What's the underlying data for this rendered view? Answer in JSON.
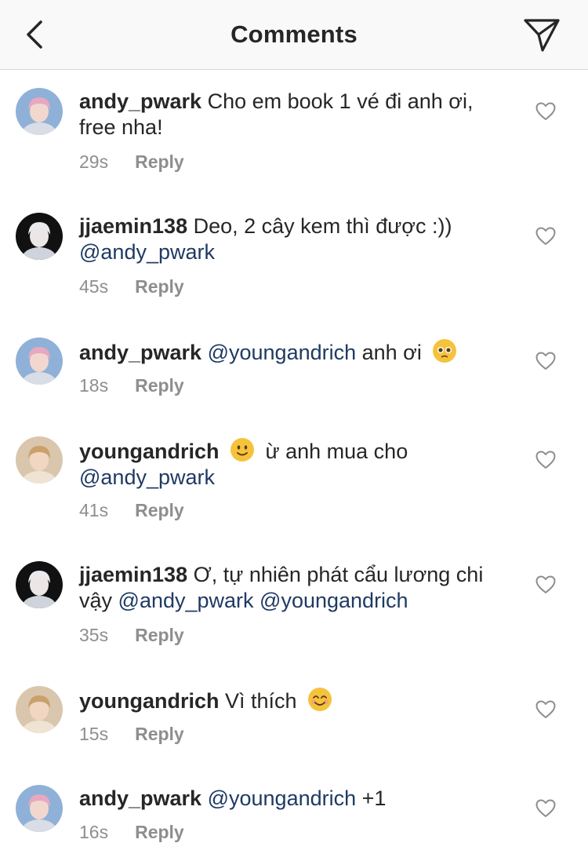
{
  "header": {
    "title": "Comments",
    "back_icon": "chevron-left-icon",
    "share_icon": "paper-plane-icon"
  },
  "reply_label": "Reply",
  "comments": [
    {
      "username": "andy_pwark",
      "parts": [
        {
          "t": "text",
          "v": "Cho em book 1 vé đi anh ơi,"
        },
        {
          "t": "br"
        },
        {
          "t": "text",
          "v": "free nha!"
        }
      ],
      "time": "29s",
      "avatar": "pink"
    },
    {
      "username": "jjaemin138",
      "parts": [
        {
          "t": "text",
          "v": "Deo, 2 cây kem thì được :))"
        },
        {
          "t": "br"
        },
        {
          "t": "mention",
          "v": "@andy_pwark"
        }
      ],
      "time": "45s",
      "avatar": "dark"
    },
    {
      "username": "andy_pwark",
      "parts": [
        {
          "t": "mention",
          "v": "@youngandrich"
        },
        {
          "t": "text",
          "v": " anh ơi "
        },
        {
          "t": "emoji",
          "v": "pleading-face-emoji"
        }
      ],
      "time": "18s",
      "avatar": "pink"
    },
    {
      "username": "youngandrich",
      "parts": [
        {
          "t": "emoji",
          "v": "slightly-smiling-face-emoji"
        },
        {
          "t": "text",
          "v": " ừ anh mua cho"
        },
        {
          "t": "br"
        },
        {
          "t": "mention",
          "v": "@andy_pwark"
        }
      ],
      "time": "41s",
      "avatar": "warm"
    },
    {
      "username": "jjaemin138",
      "parts": [
        {
          "t": "text",
          "v": "Ơ, tự nhiên phát cẩu lương chi"
        },
        {
          "t": "br"
        },
        {
          "t": "text",
          "v": "vậy "
        },
        {
          "t": "mention",
          "v": "@andy_pwark"
        },
        {
          "t": "text",
          "v": " "
        },
        {
          "t": "mention",
          "v": "@youngandrich"
        }
      ],
      "time": "35s",
      "avatar": "dark"
    },
    {
      "username": "youngandrich",
      "parts": [
        {
          "t": "text",
          "v": "Vì thích "
        },
        {
          "t": "emoji",
          "v": "smiling-face-emoji"
        }
      ],
      "time": "15s",
      "avatar": "warm"
    },
    {
      "username": "andy_pwark",
      "parts": [
        {
          "t": "mention",
          "v": "@youngandrich"
        },
        {
          "t": "text",
          "v": " +1"
        }
      ],
      "time": "16s",
      "avatar": "pink"
    }
  ],
  "colors": {
    "mention": "#1f3a63",
    "meta": "#8e8e8e",
    "header_bg": "#f9f9f9"
  }
}
